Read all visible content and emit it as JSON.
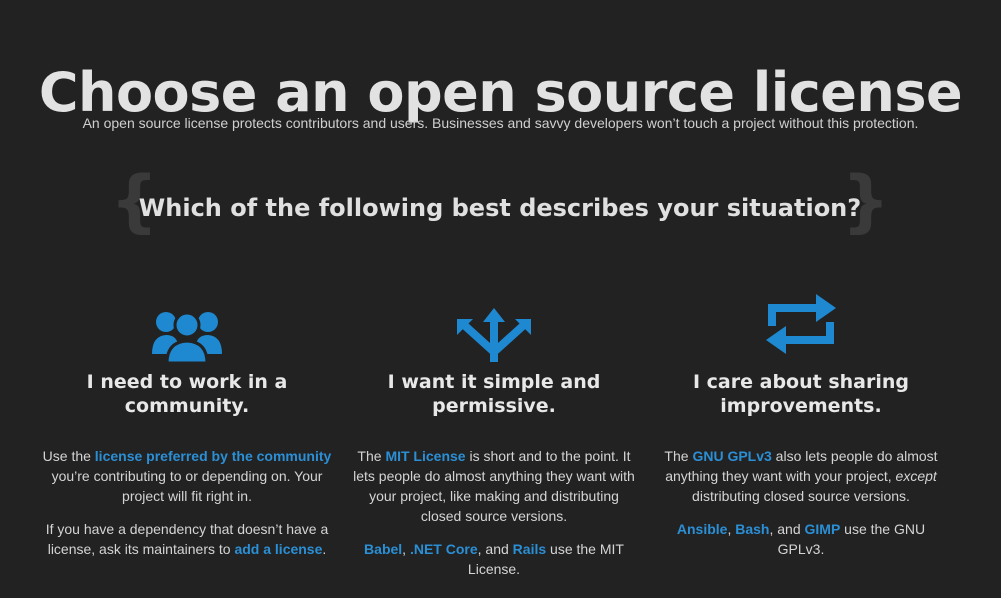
{
  "header": {
    "title": "Choose an open source license",
    "intro": "An open source license protects contributors and users. Businesses and savvy developers won’t touch a project without this protection."
  },
  "question": {
    "text": "Which of the following best describes your situation?",
    "open_brace": "{",
    "close_brace": "}"
  },
  "colors": {
    "background": "#222222",
    "accent": "#1e88d0",
    "link": "#2b8fd6"
  },
  "cards": [
    {
      "icon": "users-icon",
      "title_line1": "I need to work in a",
      "title_line2": "community.",
      "p1_a": "Use the ",
      "p1_link": "license preferred by the community",
      "p1_b": " you’re contributing to or depending on. Your project will fit right in.",
      "p2_a": "If you have a dependency that doesn’t have a license, ask its maintainers to ",
      "p2_link": "add a license",
      "p2_b": "."
    },
    {
      "icon": "arrows-split-icon",
      "title_line1": "I want it simple and",
      "title_line2": "permissive.",
      "p1_a": "The ",
      "p1_link": "MIT License",
      "p1_b": " is short and to the point. It lets people do almost anything they want with your project, like making and distributing closed source versions.",
      "p2_link1": "Babel",
      "p2_sep1": ", ",
      "p2_link2": ".NET Core",
      "p2_sep2": ", and ",
      "p2_link3": "Rails",
      "p2_b": " use the MIT License."
    },
    {
      "icon": "repeat-icon",
      "title_line1": "I care about sharing",
      "title_line2": "improvements.",
      "p1_a": "The ",
      "p1_link": "GNU GPLv3",
      "p1_b": " also lets people do almost anything they want with your project, ",
      "p1_em": "except",
      "p1_c": " distributing closed source versions.",
      "p2_link1": "Ansible",
      "p2_sep1": ", ",
      "p2_link2": "Bash",
      "p2_sep2": ", and ",
      "p2_link3": "GIMP",
      "p2_b": " use the GNU GPLv3."
    }
  ]
}
